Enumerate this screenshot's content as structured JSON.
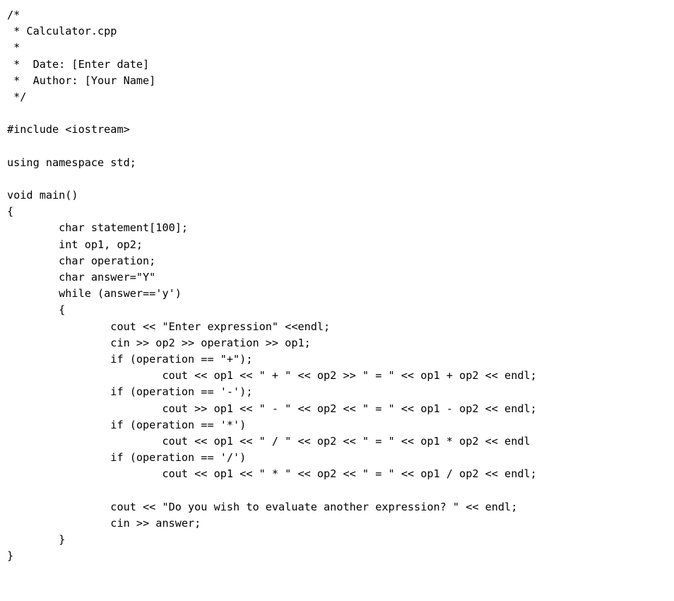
{
  "document": {
    "kind": "source-code-listing",
    "language": "cpp",
    "file_name": "Calculator.cpp",
    "background_color": "#ffffff",
    "text_color": "#000000",
    "tab_width_chars": 8,
    "lines": [
      "/*",
      " * Calculator.cpp",
      " *",
      " *  Date: [Enter date]",
      " *  Author: [Your Name]",
      " */",
      "",
      "#include <iostream>",
      "",
      "using namespace std;",
      "",
      "void main()",
      "{",
      "        char statement[100];",
      "        int op1, op2;",
      "        char operation;",
      "        char answer=\"Y\"",
      "        while (answer=='y')",
      "        {",
      "                cout << \"Enter expression\" <<endl;",
      "                cin >> op2 >> operation >> op1;",
      "                if (operation == \"+\");",
      "                        cout << op1 << \" + \" << op2 >> \" = \" << op1 + op2 << endl;",
      "                if (operation == '-');",
      "                        cout >> op1 << \" - \" << op2 << \" = \" << op1 - op2 << endl;",
      "                if (operation == '*')",
      "                        cout << op1 << \" / \" << op2 << \" = \" << op1 * op2 << endl",
      "                if (operation == '/')",
      "                        cout << op1 << \" * \" << op2 << \" = \" << op1 / op2 << endl;",
      "",
      "                cout << \"Do you wish to evaluate another expression? \" << endl;",
      "                cin >> answer;",
      "        }",
      "}"
    ]
  }
}
